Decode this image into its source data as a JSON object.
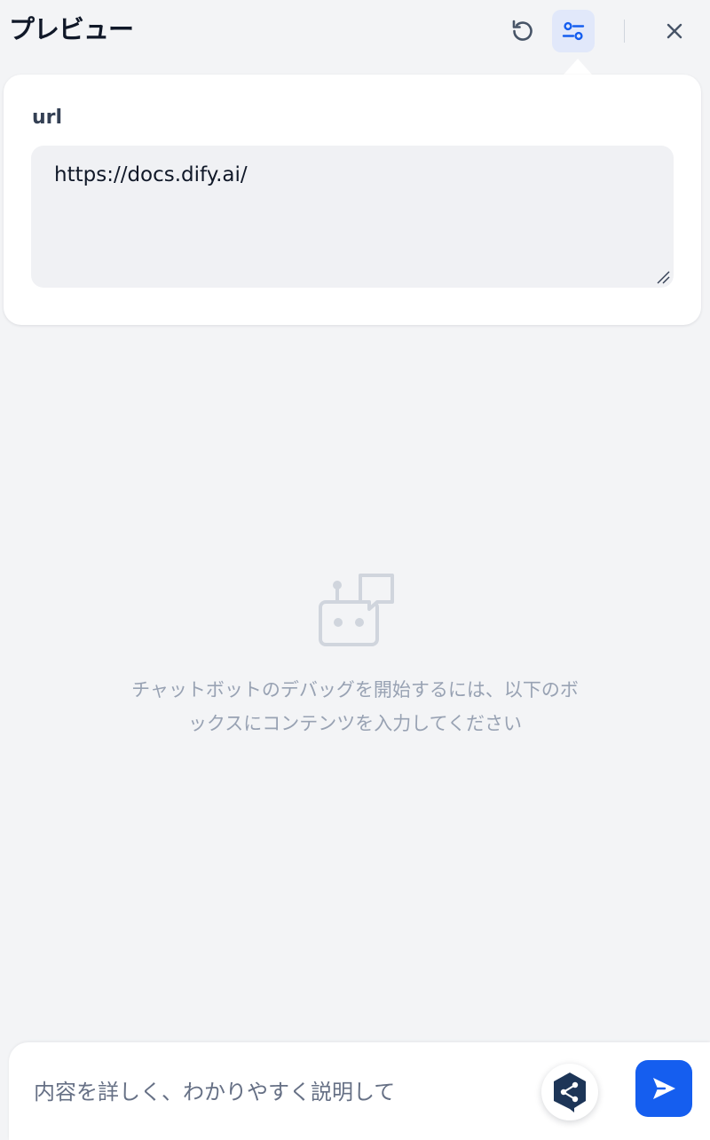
{
  "header": {
    "title": "プレビュー",
    "icons": {
      "refresh": "refresh-icon",
      "settings": "settings-sliders-icon",
      "close": "close-icon"
    }
  },
  "variables_panel": {
    "field_label": "url",
    "field_value": "https://docs.dify.ai/"
  },
  "empty_state": {
    "icon": "chatbot-icon",
    "message": "チャットボットのデバッグを開始するには、以下のボックスにコンテンツを入力してください"
  },
  "chat_input": {
    "placeholder": "内容を詳しく、わかりやすく説明して",
    "extension_icon": "share-hexagon-icon",
    "send_icon": "send-icon"
  },
  "colors": {
    "accent": "#155eef",
    "background": "#f3f4f6",
    "settings_active_bg": "#e1e8fa",
    "muted_text": "#98a2b3"
  }
}
